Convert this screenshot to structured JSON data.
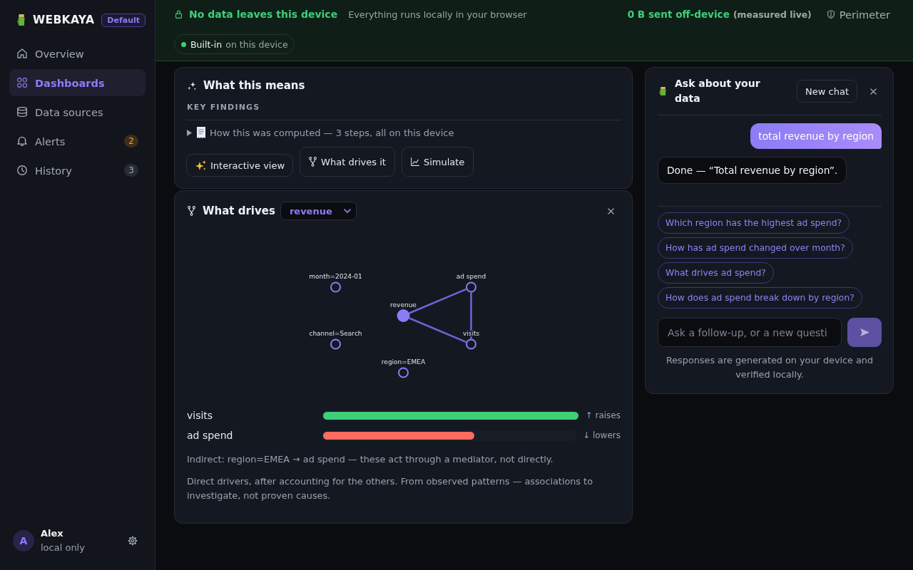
{
  "sidebar": {
    "brand": "WEBKAYA",
    "workspace": "Default",
    "items": [
      {
        "label": "Overview",
        "selected": false
      },
      {
        "label": "Dashboards",
        "selected": true
      },
      {
        "label": "Data sources",
        "selected": false
      },
      {
        "label": "Alerts",
        "selected": false,
        "badge": {
          "text": "2",
          "kind": "warning"
        }
      },
      {
        "label": "History",
        "selected": false,
        "badge": {
          "text": "3",
          "kind": "neutral"
        }
      }
    ],
    "user": {
      "initial": "A",
      "name": "Alex",
      "note": "local only"
    }
  },
  "banner": {
    "title": "No data leaves this device",
    "subtitle": "Everything runs locally in your browser",
    "sent": "0 B sent off-device",
    "sent_note": "(measured live)",
    "perimeter": "Perimeter",
    "engine": {
      "name": "Built-in",
      "note": "on this device"
    }
  },
  "meaning": {
    "title": "What this means",
    "section": "KEY FINDINGS",
    "computed": {
      "text": "How this was computed — 3 steps, all on this device",
      "expanded": false
    },
    "actions": [
      {
        "label": "Interactive view",
        "kind": "view"
      },
      {
        "label": "What drives it",
        "kind": "tool"
      },
      {
        "label": "Simulate",
        "kind": "tool"
      }
    ]
  },
  "drivers_card": {
    "title": "What drives",
    "target": "revenue",
    "graph": {
      "nodes": [
        {
          "label": "month=2024-01",
          "kind": "factor",
          "linked": false
        },
        {
          "label": "ad spend",
          "kind": "factor",
          "linked": true
        },
        {
          "label": "revenue",
          "kind": "target",
          "linked": true
        },
        {
          "label": "channel=Search",
          "kind": "factor",
          "linked": false
        },
        {
          "label": "visits",
          "kind": "factor",
          "linked": true
        },
        {
          "label": "region=EMEA",
          "kind": "factor",
          "linked": false
        }
      ]
    },
    "drivers": [
      {
        "name": "visits",
        "level": 1,
        "effect": "↑ raises",
        "kind": "positive"
      },
      {
        "name": "ad spend",
        "level": 0.6,
        "effect": "↓ lowers",
        "kind": "negative"
      }
    ],
    "indirect": "Indirect: region=EMEA → ad spend — these act through a mediator, not directly.",
    "note": "Direct drivers, after accounting for the others. From observed patterns — associations to investigate, not proven causes."
  },
  "chat": {
    "title": "Ask about your data",
    "new_chat": "New chat",
    "messages": [
      {
        "kind": "user",
        "text": "total revenue by region"
      },
      {
        "kind": "assistant",
        "text": "Done — “Total revenue by region”."
      }
    ],
    "suggestions": [
      "Which region has the highest ad spend?",
      "How has ad spend changed over month?",
      "What drives ad spend?",
      "How does ad spend break down by region?"
    ],
    "input": {
      "placeholder": "Ask a follow-up, or a new questi"
    },
    "footer": "Responses are generated on your device and verified locally."
  }
}
